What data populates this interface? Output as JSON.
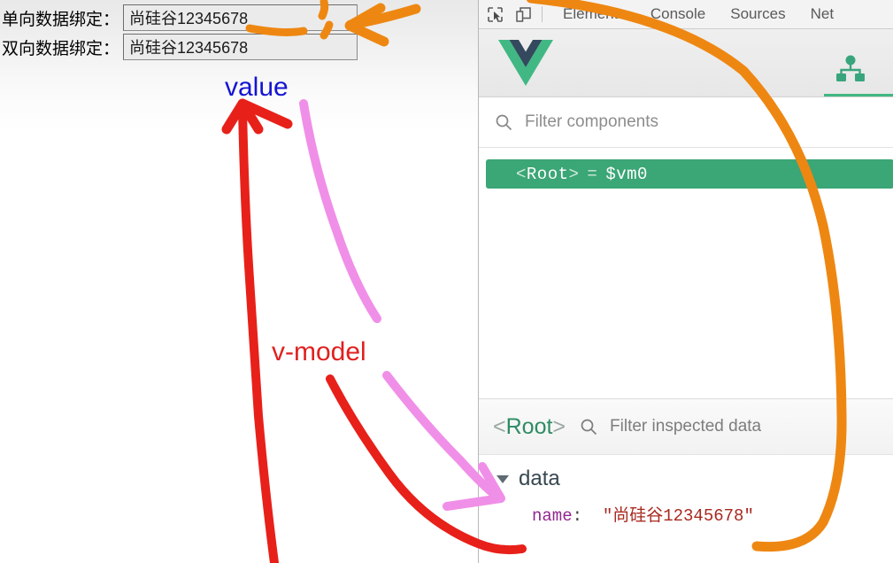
{
  "page": {
    "fields": [
      {
        "name": "one-way",
        "label": "单向数据绑定：",
        "value": "尚硅谷12345678"
      },
      {
        "name": "two-way",
        "label": "双向数据绑定：",
        "value": "尚硅谷12345678"
      }
    ]
  },
  "annotations": {
    "value_label": "value",
    "vmodel_label": "v-model",
    "colors": {
      "value_text": "#1414d2",
      "vmodel_text": "#e02020",
      "red_arrow": "#e8201a",
      "pink_arrow": "#f08fe8",
      "orange_arrow": "#ee8712"
    }
  },
  "devtools": {
    "toolbar": {
      "inspect_icon": "inspect-element-icon",
      "device_icon": "device-toolbar-icon",
      "tabs": [
        {
          "label": "Elements",
          "active": false
        },
        {
          "label": "Console",
          "active": false
        },
        {
          "label": "Sources",
          "active": false
        },
        {
          "label": "Net",
          "active": false
        }
      ]
    },
    "vue_panel": {
      "logo": "vue-logo-icon",
      "active_tab_icon": "component-tree-icon",
      "accent": "#42b883"
    },
    "components_filter": {
      "icon": "search-icon",
      "placeholder": "Filter components"
    },
    "tree": {
      "selected_node": {
        "open_angle": "<",
        "name": "Root",
        "close_angle": ">",
        "equals": "=",
        "vm_ref": "$vm0",
        "background": "#3ba676"
      }
    },
    "inspector": {
      "root_open_angle": "<",
      "root_name": "Root",
      "root_close_angle": ">",
      "filter_icon": "search-icon",
      "filter_placeholder": "Filter inspected data",
      "sections": [
        {
          "name": "data",
          "expanded": true,
          "props": [
            {
              "key": "name",
              "separator": ":",
              "value": "\"尚硅谷12345678\""
            }
          ]
        }
      ]
    }
  }
}
